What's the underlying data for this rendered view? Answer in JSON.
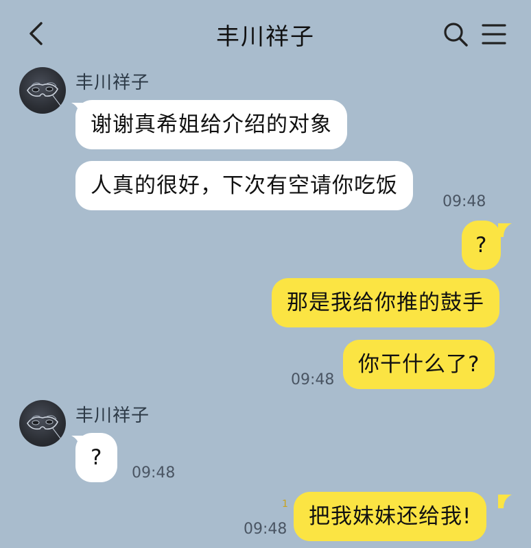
{
  "header": {
    "title": "丰川祥子"
  },
  "messages": [
    {
      "sender": "丰川祥子",
      "text": "谢谢真希姐给介绍的对象"
    },
    {
      "text": "人真的很好，下次有空请你吃饭",
      "time": "09:48"
    },
    {
      "text": "?"
    },
    {
      "text": "那是我给你推的鼓手"
    },
    {
      "text": "你干什么了?",
      "time": "09:48"
    },
    {
      "sender": "丰川祥子",
      "text": "?",
      "time": "09:48"
    },
    {
      "text": "把我妹妹还给我!",
      "time": "09:48",
      "read_mark": "1"
    }
  ],
  "icons": {
    "back": "chevron-left-icon",
    "search": "search-icon",
    "menu": "menu-icon",
    "avatar": "mask-avatar"
  },
  "colors": {
    "background": "#a9bccd",
    "incoming_bubble": "#ffffff",
    "outgoing_bubble": "#fbe443"
  }
}
